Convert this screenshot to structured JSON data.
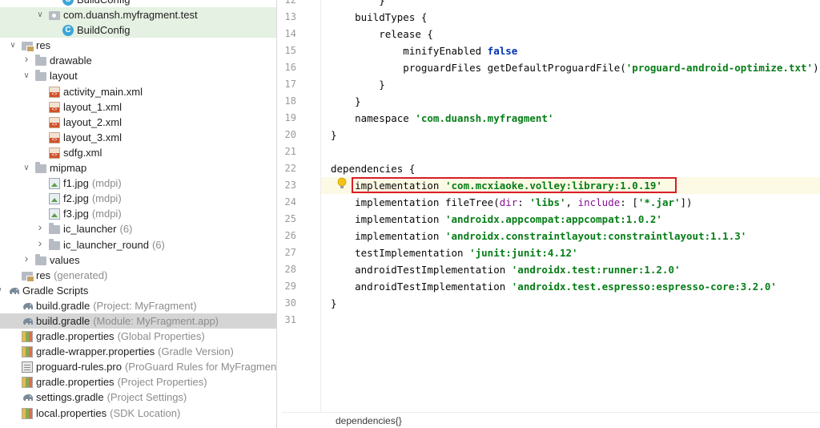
{
  "tree": {
    "rows": [
      {
        "indent": 3,
        "arrow": "",
        "icon": "class",
        "label": "BuildConfig",
        "hint": "",
        "sel": ""
      },
      {
        "indent": 2,
        "arrow": "v",
        "icon": "pkg",
        "label": "com.duansh.myfragment.test",
        "hint": "",
        "sel": "light"
      },
      {
        "indent": 3,
        "arrow": "",
        "icon": "class",
        "label": "BuildConfig",
        "hint": "",
        "sel": "light"
      },
      {
        "indent": 0,
        "arrow": "v",
        "icon": "resfolder",
        "label": "res",
        "hint": "",
        "sel": ""
      },
      {
        "indent": 1,
        "arrow": ">",
        "icon": "folder",
        "label": "drawable",
        "hint": "",
        "sel": ""
      },
      {
        "indent": 1,
        "arrow": "v",
        "icon": "folder",
        "label": "layout",
        "hint": "",
        "sel": ""
      },
      {
        "indent": 2,
        "arrow": "",
        "icon": "xml",
        "label": "activity_main.xml",
        "hint": "",
        "sel": ""
      },
      {
        "indent": 2,
        "arrow": "",
        "icon": "xml",
        "label": "layout_1.xml",
        "hint": "",
        "sel": ""
      },
      {
        "indent": 2,
        "arrow": "",
        "icon": "xml",
        "label": "layout_2.xml",
        "hint": "",
        "sel": ""
      },
      {
        "indent": 2,
        "arrow": "",
        "icon": "xml",
        "label": "layout_3.xml",
        "hint": "",
        "sel": ""
      },
      {
        "indent": 2,
        "arrow": "",
        "icon": "xml",
        "label": "sdfg.xml",
        "hint": "",
        "sel": ""
      },
      {
        "indent": 1,
        "arrow": "v",
        "icon": "folder",
        "label": "mipmap",
        "hint": "",
        "sel": ""
      },
      {
        "indent": 2,
        "arrow": "",
        "icon": "img",
        "label": "f1.jpg",
        "hint": "(mdpi)",
        "sel": ""
      },
      {
        "indent": 2,
        "arrow": "",
        "icon": "img",
        "label": "f2.jpg",
        "hint": "(mdpi)",
        "sel": ""
      },
      {
        "indent": 2,
        "arrow": "",
        "icon": "img",
        "label": "f3.jpg",
        "hint": "(mdpi)",
        "sel": ""
      },
      {
        "indent": 2,
        "arrow": ">",
        "icon": "folder",
        "label": "ic_launcher",
        "hint": "(6)",
        "sel": ""
      },
      {
        "indent": 2,
        "arrow": ">",
        "icon": "folder",
        "label": "ic_launcher_round",
        "hint": "(6)",
        "sel": ""
      },
      {
        "indent": 1,
        "arrow": ">",
        "icon": "folder",
        "label": "values",
        "hint": "",
        "sel": ""
      },
      {
        "indent": 0,
        "arrow": "",
        "icon": "resfolder",
        "label": "res",
        "hint": "(generated)",
        "sel": ""
      },
      {
        "indent": -1,
        "arrow": "v",
        "icon": "elephant",
        "label": "Gradle Scripts",
        "hint": "",
        "sel": ""
      },
      {
        "indent": 0,
        "arrow": "",
        "icon": "elephant",
        "label": "build.gradle",
        "hint": "(Project: MyFragment)",
        "sel": ""
      },
      {
        "indent": 0,
        "arrow": "",
        "icon": "elephant",
        "label": "build.gradle",
        "hint": "(Module: MyFragment.app)",
        "sel": "gray"
      },
      {
        "indent": 0,
        "arrow": "",
        "icon": "prop",
        "label": "gradle.properties",
        "hint": "(Global Properties)",
        "sel": ""
      },
      {
        "indent": 0,
        "arrow": "",
        "icon": "prop",
        "label": "gradle-wrapper.properties",
        "hint": "(Gradle Version)",
        "sel": ""
      },
      {
        "indent": 0,
        "arrow": "",
        "icon": "pro",
        "label": "proguard-rules.pro",
        "hint": "(ProGuard Rules for MyFragment.ap",
        "sel": ""
      },
      {
        "indent": 0,
        "arrow": "",
        "icon": "prop",
        "label": "gradle.properties",
        "hint": "(Project Properties)",
        "sel": ""
      },
      {
        "indent": 0,
        "arrow": "",
        "icon": "elephant",
        "label": "settings.gradle",
        "hint": "(Project Settings)",
        "sel": ""
      },
      {
        "indent": 0,
        "arrow": "",
        "icon": "prop",
        "label": "local.properties",
        "hint": "(SDK Location)",
        "sel": ""
      }
    ]
  },
  "editor": {
    "lines": [
      {
        "n": "12",
        "fold": false,
        "html": [
          [
            "",
            "        }"
          ]
        ]
      },
      {
        "n": "13",
        "fold": true,
        "html": [
          [
            "",
            "    buildTypes {"
          ]
        ]
      },
      {
        "n": "14",
        "fold": true,
        "html": [
          [
            "",
            "        release {"
          ]
        ]
      },
      {
        "n": "15",
        "fold": false,
        "html": [
          [
            "",
            "            minifyEnabled "
          ],
          [
            "kw",
            "false"
          ]
        ]
      },
      {
        "n": "16",
        "fold": false,
        "html": [
          [
            "",
            "            proguardFiles getDefaultProguardFile("
          ],
          [
            "str",
            "'proguard-android-optimize.txt'"
          ],
          [
            "",
            ")"
          ]
        ]
      },
      {
        "n": "17",
        "fold": true,
        "html": [
          [
            "",
            "        }"
          ]
        ]
      },
      {
        "n": "18",
        "fold": false,
        "html": [
          [
            "",
            "    }"
          ]
        ]
      },
      {
        "n": "19",
        "fold": false,
        "html": [
          [
            "",
            "    namespace "
          ],
          [
            "str",
            "'com.duansh.myfragment'"
          ]
        ]
      },
      {
        "n": "20",
        "fold": true,
        "html": [
          [
            "",
            "}"
          ]
        ]
      },
      {
        "n": "21",
        "fold": false,
        "html": [
          [
            "",
            ""
          ]
        ]
      },
      {
        "n": "22",
        "fold": true,
        "html": [
          [
            "",
            "dependencies {"
          ]
        ]
      },
      {
        "n": "23",
        "fold": false,
        "caret": true,
        "html": [
          [
            "",
            "    implementation "
          ],
          [
            "str",
            "'com.mcxiaoke.volley:library:1.0.19'"
          ]
        ]
      },
      {
        "n": "24",
        "fold": false,
        "html": [
          [
            "",
            "    implementation fileTree("
          ],
          [
            "nm",
            "dir"
          ],
          [
            "",
            ": "
          ],
          [
            "str",
            "'libs'"
          ],
          [
            "",
            ", "
          ],
          [
            "nm",
            "include"
          ],
          [
            "",
            ": ["
          ],
          [
            "str",
            "'*.jar'"
          ],
          [
            "",
            "])"
          ]
        ]
      },
      {
        "n": "25",
        "fold": false,
        "html": [
          [
            "",
            "    implementation "
          ],
          [
            "str",
            "'androidx.appcompat:appcompat:1.0.2'"
          ]
        ]
      },
      {
        "n": "26",
        "fold": false,
        "html": [
          [
            "",
            "    implementation "
          ],
          [
            "str",
            "'androidx.constraintlayout:constraintlayout:1.1.3'"
          ]
        ]
      },
      {
        "n": "27",
        "fold": false,
        "html": [
          [
            "",
            "    testImplementation "
          ],
          [
            "str",
            "'junit:junit:4.12'"
          ]
        ]
      },
      {
        "n": "28",
        "fold": false,
        "html": [
          [
            "",
            "    androidTestImplementation "
          ],
          [
            "str",
            "'androidx.test:runner:1.2.0'"
          ]
        ]
      },
      {
        "n": "29",
        "fold": false,
        "html": [
          [
            "",
            "    androidTestImplementation "
          ],
          [
            "str",
            "'androidx.test.espresso:espresso-core:3.2.0'"
          ]
        ]
      },
      {
        "n": "30",
        "fold": true,
        "html": [
          [
            "",
            "}"
          ]
        ]
      },
      {
        "n": "31",
        "fold": false,
        "html": [
          [
            "",
            ""
          ]
        ]
      }
    ]
  },
  "breadcrumb": "dependencies{}",
  "colors": {
    "highlight_border": "#d81e2a",
    "string": "#067d17",
    "keyword": "#0033b3",
    "param": "#871094"
  }
}
